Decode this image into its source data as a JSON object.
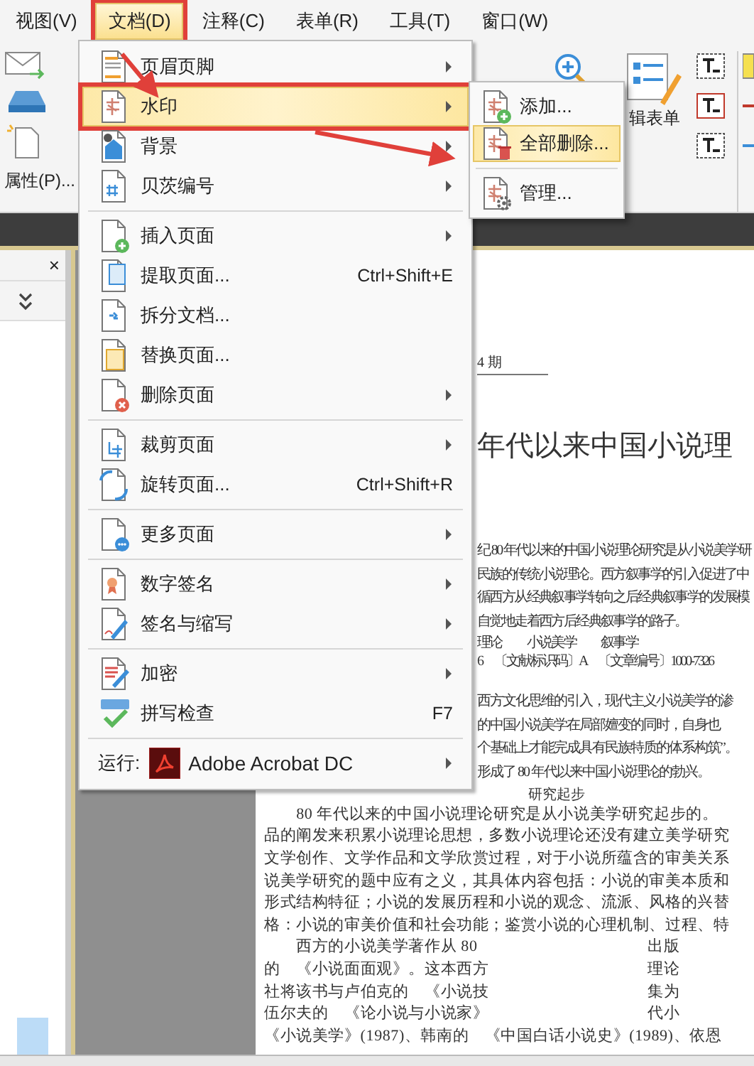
{
  "menu_bar": [
    {
      "label": "视图(V)",
      "selected": false,
      "highlighted": false
    },
    {
      "label": "文档(D)",
      "selected": true,
      "highlighted": true
    },
    {
      "label": "注释(C)",
      "selected": false,
      "highlighted": false
    },
    {
      "label": "表单(R)",
      "selected": false,
      "highlighted": false
    },
    {
      "label": "工具(T)",
      "selected": false,
      "highlighted": false
    },
    {
      "label": "窗口(W)",
      "selected": false,
      "highlighted": false
    }
  ],
  "toolbar": {
    "form_button_label": "辑表单",
    "properties_label": "属性(P)..."
  },
  "document_menu": [
    {
      "kind": "item",
      "label": "页眉页脚",
      "submenu": true,
      "selected": false,
      "highlighted": false
    },
    {
      "kind": "item",
      "label": "水印",
      "submenu": true,
      "selected": true,
      "highlighted": true
    },
    {
      "kind": "item",
      "label": "背景",
      "submenu": true,
      "selected": false,
      "highlighted": false
    },
    {
      "kind": "item",
      "label": "贝茨编号",
      "submenu": true,
      "selected": false,
      "highlighted": false
    },
    {
      "kind": "separator"
    },
    {
      "kind": "item",
      "label": "插入页面",
      "submenu": true,
      "selected": false,
      "highlighted": false
    },
    {
      "kind": "item",
      "label": "提取页面...",
      "shortcut": "Ctrl+Shift+E",
      "submenu": false,
      "selected": false,
      "highlighted": false
    },
    {
      "kind": "item",
      "label": "拆分文档...",
      "submenu": false,
      "selected": false,
      "highlighted": false
    },
    {
      "kind": "item",
      "label": "替换页面...",
      "submenu": false,
      "selected": false,
      "highlighted": false
    },
    {
      "kind": "item",
      "label": "删除页面",
      "submenu": true,
      "selected": false,
      "highlighted": false
    },
    {
      "kind": "separator"
    },
    {
      "kind": "item",
      "label": "裁剪页面",
      "submenu": true,
      "selected": false,
      "highlighted": false
    },
    {
      "kind": "item",
      "label": "旋转页面...",
      "shortcut": "Ctrl+Shift+R",
      "submenu": false,
      "selected": false,
      "highlighted": false
    },
    {
      "kind": "separator"
    },
    {
      "kind": "item",
      "label": "更多页面",
      "submenu": true,
      "selected": false,
      "highlighted": false
    },
    {
      "kind": "separator"
    },
    {
      "kind": "item",
      "label": "数字签名",
      "submenu": true,
      "selected": false,
      "highlighted": false
    },
    {
      "kind": "item",
      "label": "签名与缩写",
      "submenu": true,
      "selected": false,
      "highlighted": false
    },
    {
      "kind": "separator"
    },
    {
      "kind": "item",
      "label": "加密",
      "submenu": true,
      "selected": false,
      "highlighted": false
    },
    {
      "kind": "item",
      "label": "拼写检查",
      "shortcut": "F7",
      "submenu": false,
      "selected": false,
      "highlighted": false
    },
    {
      "kind": "separator"
    },
    {
      "kind": "run",
      "label": "运行:",
      "app": "Adobe Acrobat DC",
      "submenu": true,
      "selected": false,
      "highlighted": false
    }
  ],
  "watermark_submenu": [
    {
      "kind": "item",
      "label": "添加...",
      "selected": false
    },
    {
      "kind": "item",
      "label": "全部删除...",
      "selected": true
    },
    {
      "kind": "separator"
    },
    {
      "kind": "item",
      "label": "管理...",
      "selected": false
    }
  ],
  "left_panel": {
    "close_glyph": "×"
  },
  "document": {
    "issue": "4 期",
    "title": "年代以来中国小说理",
    "abstract_lines": [
      "纪 80 年代以来的中国小说理论研究是从小说美学研",
      "民族的传统小说理论。西方叙事学的引入促进了中",
      "循西方从经典叙事学转向之后经典叙事学的发展模",
      "自觉地走着西方后经典叙事学的路子。"
    ],
    "keywords": "理论　　小说美学　　叙事学",
    "classification": "6　〔文献标识码〕A　〔文章编号〕1000-7326",
    "intro_lines": [
      "西方文化思维的引入，现代主义小说美学的渗",
      "的中国小说美学在局部嬗变的同时，自身也",
      "个基础上才能完成具有民族特质的体系构筑”。",
      "形成了 80 年代以来中国小说理论的勃兴。"
    ],
    "section_heading": "研究起步",
    "body_lines": [
      {
        "text": "　　80 年代以来的中国小说理论研究是从小说美学研究起步的。"
      },
      {
        "text": "品的阐发来积累小说理论思想，多数小说理论还没有建立美学研究"
      },
      {
        "text": "文学创作、文学作品和文学欣赏过程，对于小说所蕴含的审美关系"
      },
      {
        "text": "说美学研究的题中应有之义，其具体内容包括：小说的审美本质和"
      },
      {
        "text": "形式结构特征；小说的发展历程和小说的观念、流派、风格的兴替"
      },
      {
        "text": "格：小说的审美价值和社会功能；鉴赏小说的心理机制、过程、特"
      },
      {
        "text": "　　西方的小说美学著作从 80",
        "right": "出版"
      },
      {
        "text": "的　《小说面面观》。这本西方",
        "right": "理论"
      },
      {
        "text": "社将该书与卢伯克的　《小说技",
        "right": "集为"
      },
      {
        "text": "伍尔夫的　《论小说与小说家》",
        "right": "代小"
      },
      {
        "text": "《小说美学》(1987)、韩南的　《中国白话小说史》(1989)、依恩"
      }
    ]
  }
}
